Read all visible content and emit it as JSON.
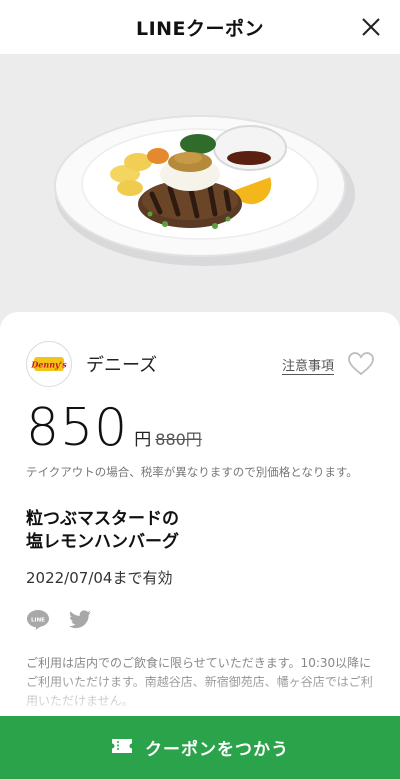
{
  "header": {
    "title": "LINEクーポン",
    "close_icon": "close-icon"
  },
  "hero": {
    "image": "hamburg-steak-plate-photo"
  },
  "store": {
    "name": "デニーズ",
    "logo_text": "Denny's",
    "notice_label": "注意事項",
    "favorite_icon": "heart-outline-icon"
  },
  "price": {
    "value": "850",
    "unit": "円",
    "original": "880円"
  },
  "tax_note": "テイクアウトの場合、税率が異なりますので別価格となります。",
  "product": {
    "name": "粒つぶマスタードの\n塩レモンハンバーグ"
  },
  "valid_until": "2022/07/04まで有効",
  "share": {
    "line_icon": "line-share-icon",
    "twitter_icon": "twitter-share-icon"
  },
  "usage_note": "ご利用は店内でのご飲食に限らせていただきます。10:30以降にご利用いただけます。南越谷店、新宿御苑店、幡ヶ谷店ではご利用いただけません。",
  "cta": {
    "label": "クーポンをつかう",
    "icon": "ticket-icon"
  },
  "colors": {
    "accent": "#2ba34a",
    "text": "#222222",
    "muted": "#777777",
    "hero_bg": "#ececed"
  }
}
